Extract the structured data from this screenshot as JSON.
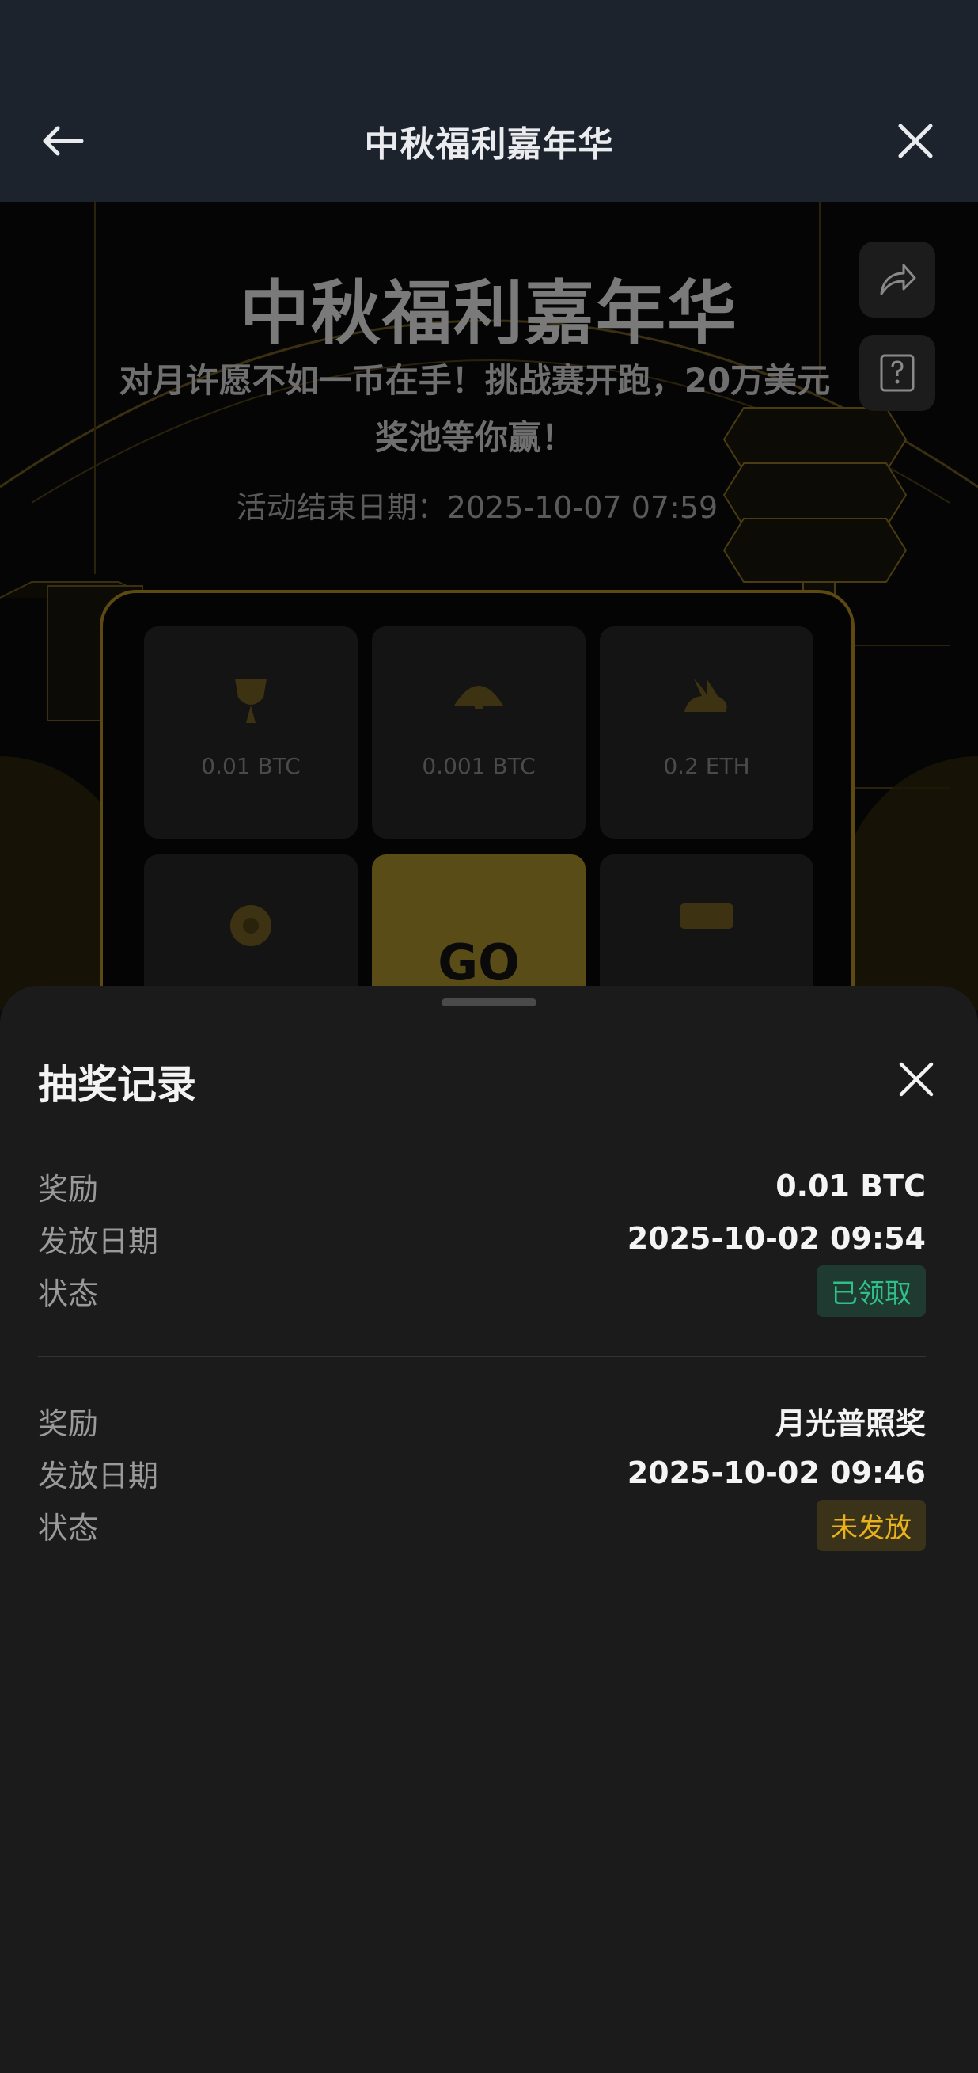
{
  "nav": {
    "title": "中秋福利嘉年华",
    "back_icon": "arrow-left-icon",
    "close_icon": "close-icon"
  },
  "event": {
    "title": "中秋福利嘉年华",
    "subtitle": "对月许愿不如一币在手！挑战赛开跑，20万美元奖池等你赢！",
    "end_date": "活动结束日期：2025-10-07 07:59"
  },
  "grid": {
    "cells": [
      {
        "label": "0.01 BTC",
        "icon": "fan-icon"
      },
      {
        "label": "0.001 BTC",
        "icon": "folding-fan-icon"
      },
      {
        "label": "0.2 ETH",
        "icon": "rabbit-icon"
      },
      {
        "label": "",
        "icon": "flower-icon"
      },
      {
        "label": "GO",
        "icon": ""
      },
      {
        "label": "",
        "icon": "coupon-icon"
      }
    ]
  },
  "sheet": {
    "title": "抽奖记录",
    "records": [
      {
        "reward_label": "奖励",
        "reward_value": "0.01 BTC",
        "date_label": "发放日期",
        "date_value": "2025-10-02 09:54",
        "status_label": "状态",
        "status_value": "已领取"
      },
      {
        "reward_label": "奖励",
        "reward_value": "月光普照奖",
        "date_label": "发放日期",
        "date_value": "2025-10-02 09:46",
        "status_label": "状态",
        "status_value": "未发放"
      }
    ]
  },
  "colors": {
    "claimed": "#2fbf8a",
    "pending": "#e8b21a",
    "accent_gold": "#c9a227"
  }
}
